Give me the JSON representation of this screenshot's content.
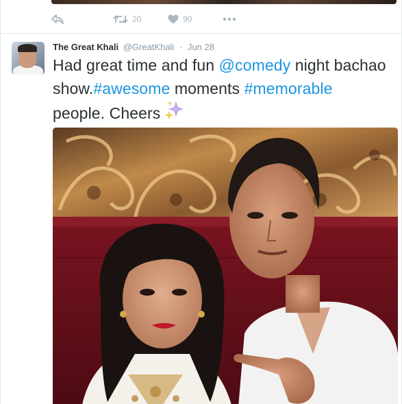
{
  "previous_tweet": {
    "actions": {
      "reply": {
        "icon": "reply-icon"
      },
      "retweet": {
        "icon": "retweet-icon",
        "count": "20"
      },
      "like": {
        "icon": "heart-icon",
        "count": "90"
      },
      "more": {
        "icon": "more-dots-icon"
      }
    }
  },
  "tweet": {
    "author": {
      "fullname": "The Great Khali",
      "username": "@GreatKhali"
    },
    "separator": "·",
    "time": "Jun 28",
    "text": {
      "part1": "Had great time and fun ",
      "mention": "@comedy",
      "part2": " night bachao show.",
      "hashtag1": "#awesome",
      "part3": " moments ",
      "hashtag2": "#memorable",
      "part4": " people. Cheers"
    },
    "emoji": "sparkles-icon",
    "media": {
      "type": "photo"
    }
  },
  "colors": {
    "link": "#1b95e0",
    "text": "#292f33",
    "meta": "#8899a6",
    "action": "#aab8c2",
    "divider": "#e1e8ed"
  }
}
